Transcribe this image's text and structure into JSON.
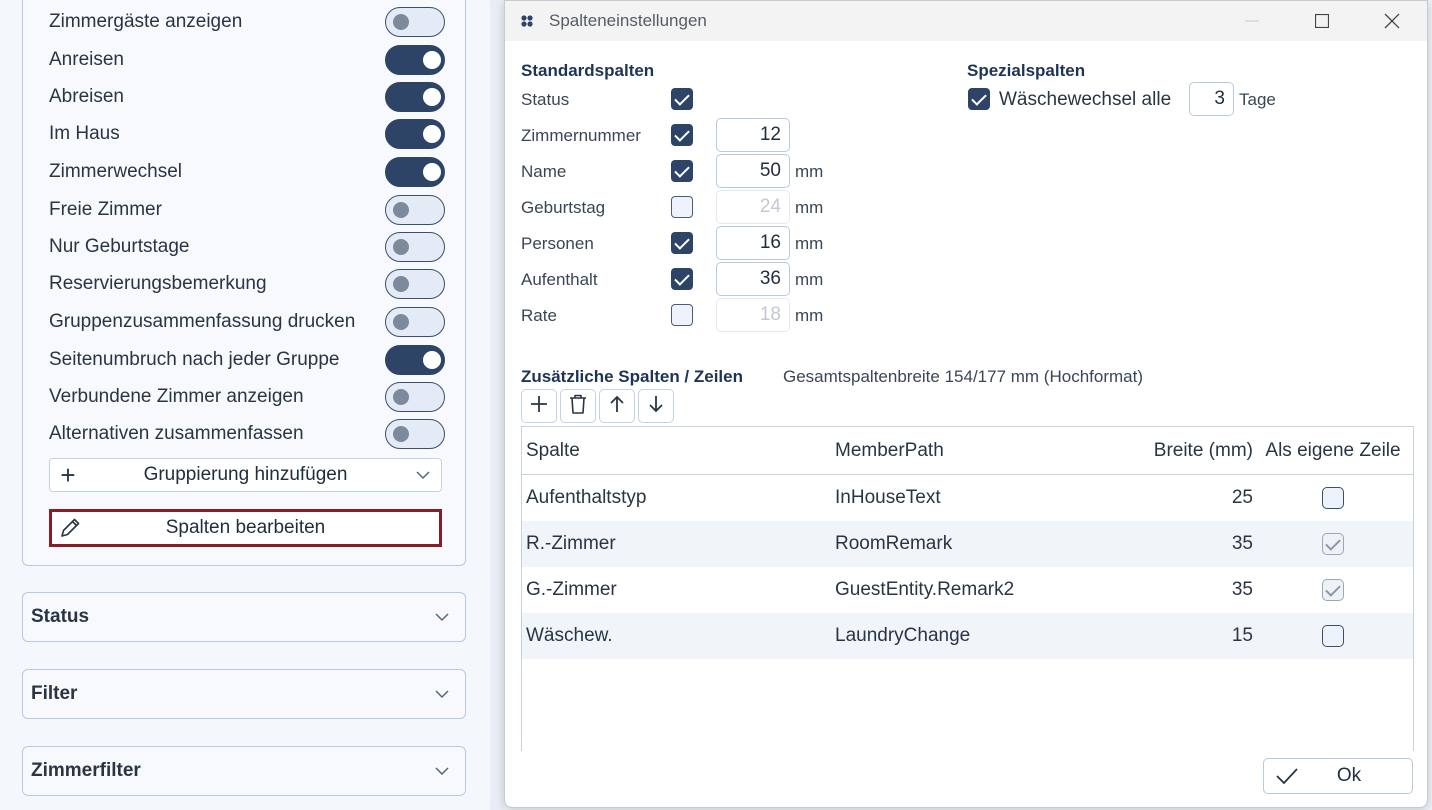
{
  "options": [
    {
      "label": "Zimmergäste anzeigen",
      "on": false
    },
    {
      "label": "Anreisen",
      "on": true
    },
    {
      "label": "Abreisen",
      "on": true
    },
    {
      "label": "Im Haus",
      "on": true
    },
    {
      "label": "Zimmerwechsel",
      "on": true
    },
    {
      "label": "Freie Zimmer",
      "on": false
    },
    {
      "label": "Nur Geburtstage",
      "on": false
    },
    {
      "label": "Reservierungsbemerkung",
      "on": false
    },
    {
      "label": "Gruppenzusammenfassung drucken",
      "on": false
    },
    {
      "label": "Seitenumbruch nach jeder Gruppe",
      "on": true
    },
    {
      "label": "Verbundene Zimmer anzeigen",
      "on": false
    },
    {
      "label": "Alternativen zusammenfassen",
      "on": false
    }
  ],
  "grouping_button": "Gruppierung hinzufügen",
  "edit_columns_button": "Spalten bearbeiten",
  "accordions": [
    "Status",
    "Filter",
    "Zimmerfilter"
  ],
  "dialog": {
    "title": "Spalteneinstellungen",
    "standard_heading": "Standardspalten",
    "special_heading": "Spezialspalten",
    "standard_columns": [
      {
        "label": "Status",
        "checked": true,
        "value": null,
        "unit": ""
      },
      {
        "label": "Zimmernummer",
        "checked": true,
        "value": "12",
        "unit": ""
      },
      {
        "label": "Name",
        "checked": true,
        "value": "50",
        "unit": "mm"
      },
      {
        "label": "Geburtstag",
        "checked": false,
        "value": "24",
        "unit": "mm"
      },
      {
        "label": "Personen",
        "checked": true,
        "value": "16",
        "unit": "mm"
      },
      {
        "label": "Aufenthalt",
        "checked": true,
        "value": "36",
        "unit": "mm"
      },
      {
        "label": "Rate",
        "checked": false,
        "value": "18",
        "unit": "mm"
      }
    ],
    "special": {
      "label": "Wäschewechsel alle",
      "checked": true,
      "value": "3",
      "unit": "Tage"
    },
    "additional_heading": "Zusätzliche Spalten / Zeilen",
    "total_width": "Gesamtspaltenbreite 154/177 mm (Hochformat)",
    "toolbar_icons": [
      "plus-icon",
      "trash-icon",
      "arrow-up-icon",
      "arrow-down-icon"
    ],
    "grid": {
      "headers": [
        "Spalte",
        "MemberPath",
        "Breite (mm)",
        "Als eigene Zeile"
      ],
      "rows": [
        {
          "col": "Aufenthaltstyp",
          "path": "InHouseText",
          "width": "25",
          "own_row": false
        },
        {
          "col": "R.-Zimmer",
          "path": "RoomRemark",
          "width": "35",
          "own_row": true
        },
        {
          "col": "G.-Zimmer",
          "path": "GuestEntity.Remark2",
          "width": "35",
          "own_row": true
        },
        {
          "col": "Wäschew.",
          "path": "LaundryChange",
          "width": "15",
          "own_row": false
        }
      ]
    },
    "ok_button": "Ok"
  },
  "colors": {
    "accent": "#2d4466",
    "highlight_border": "#8a1c2a"
  }
}
